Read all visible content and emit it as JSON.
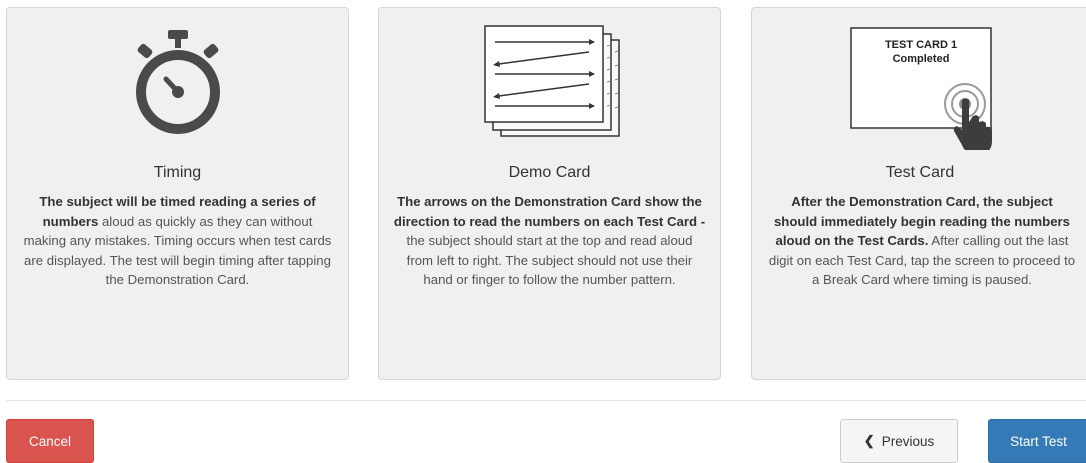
{
  "cards": [
    {
      "title": "Timing",
      "icon": "stopwatch-icon",
      "body": [
        {
          "text": "The subject will be timed reading a series of numbers",
          "bold": true
        },
        {
          "text": " aloud as quickly as they can without making any mistakes. Timing occurs when test cards are displayed. The test will begin timing after tapping the Demonstration Card.",
          "bold": false
        }
      ]
    },
    {
      "title": "Demo Card",
      "icon": "demonstration-card-icon",
      "body": [
        {
          "text": "The arrows on the Demonstration Card show the direction to read the numbers on each Test Card -",
          "bold": true
        },
        {
          "text": " the subject should start at the top and read aloud from left to right. The subject should not use their hand or finger to follow the number pattern.",
          "bold": false
        }
      ]
    },
    {
      "title": "Test Card",
      "icon": "tap-test-card-icon",
      "illustration_text": {
        "line1": "TEST CARD 1",
        "line2": "Completed"
      },
      "body": [
        {
          "text": "After the Demonstration Card, the subject should immediately begin reading the numbers aloud on the Test Cards.",
          "bold": true
        },
        {
          "text": " After calling out the last digit on each Test Card, tap the screen to proceed to a Break Card where timing is paused.",
          "bold": false
        }
      ]
    }
  ],
  "buttons": {
    "cancel": "Cancel",
    "previous": "Previous",
    "start": "Start Test"
  },
  "colors": {
    "cancel": "#d9534f",
    "primary": "#337ab7",
    "card_bg": "#f0f0f0",
    "icon": "#4a4a4a"
  }
}
